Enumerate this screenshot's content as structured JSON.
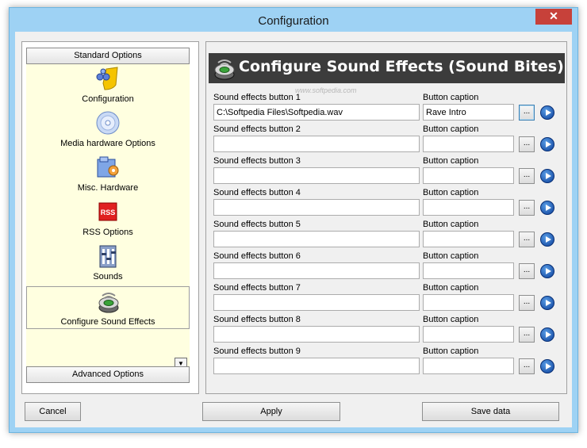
{
  "window": {
    "title": "Configuration",
    "close_glyph": "✕"
  },
  "sidebar": {
    "header_top": "Standard Options",
    "header_bottom": "Advanced Options",
    "items": [
      {
        "label": "Configuration",
        "icon": "configuration-icon"
      },
      {
        "label": "Media hardware Options",
        "icon": "cd-icon"
      },
      {
        "label": "Misc. Hardware",
        "icon": "hardware-folder-icon"
      },
      {
        "label": "RSS Options",
        "icon": "rss-icon",
        "icon_text": "RSS"
      },
      {
        "label": "Sounds",
        "icon": "sounds-icon"
      },
      {
        "label": "Configure Sound Effects",
        "icon": "speaker-icon",
        "selected": true
      }
    ],
    "scroll_glyph": "▼"
  },
  "main": {
    "title": "Configure Sound Effects (Sound Bites)",
    "watermark": "www.softpedia.com",
    "rows": [
      {
        "file_label": "Sound effects button 1",
        "caption_label": "Button caption",
        "file_value": "C:\\Softpedia Files\\Softpedia.wav",
        "caption_value": "Rave Intro"
      },
      {
        "file_label": "Sound effects button 2",
        "caption_label": "Button caption",
        "file_value": "",
        "caption_value": ""
      },
      {
        "file_label": "Sound effects button 3",
        "caption_label": "Button caption",
        "file_value": "",
        "caption_value": ""
      },
      {
        "file_label": "Sound effects button 4",
        "caption_label": "Button caption",
        "file_value": "",
        "caption_value": ""
      },
      {
        "file_label": "Sound effects button 5",
        "caption_label": "Button caption",
        "file_value": "",
        "caption_value": ""
      },
      {
        "file_label": "Sound effects button 6",
        "caption_label": "Button caption",
        "file_value": "",
        "caption_value": ""
      },
      {
        "file_label": "Sound effects button 7",
        "caption_label": "Button caption",
        "file_value": "",
        "caption_value": ""
      },
      {
        "file_label": "Sound effects button 8",
        "caption_label": "Button caption",
        "file_value": "",
        "caption_value": ""
      },
      {
        "file_label": "Sound effects button 9",
        "caption_label": "Button caption",
        "file_value": "",
        "caption_value": ""
      }
    ],
    "browse_label": "...",
    "play_icon": "play-icon"
  },
  "footer": {
    "cancel": "Cancel",
    "apply": "Apply",
    "save": "Save data"
  },
  "colors": {
    "frame": "#9ed2f4",
    "header_bar": "#3c3c3c",
    "category_bg": "#ffffe0",
    "close": "#c7413a"
  }
}
